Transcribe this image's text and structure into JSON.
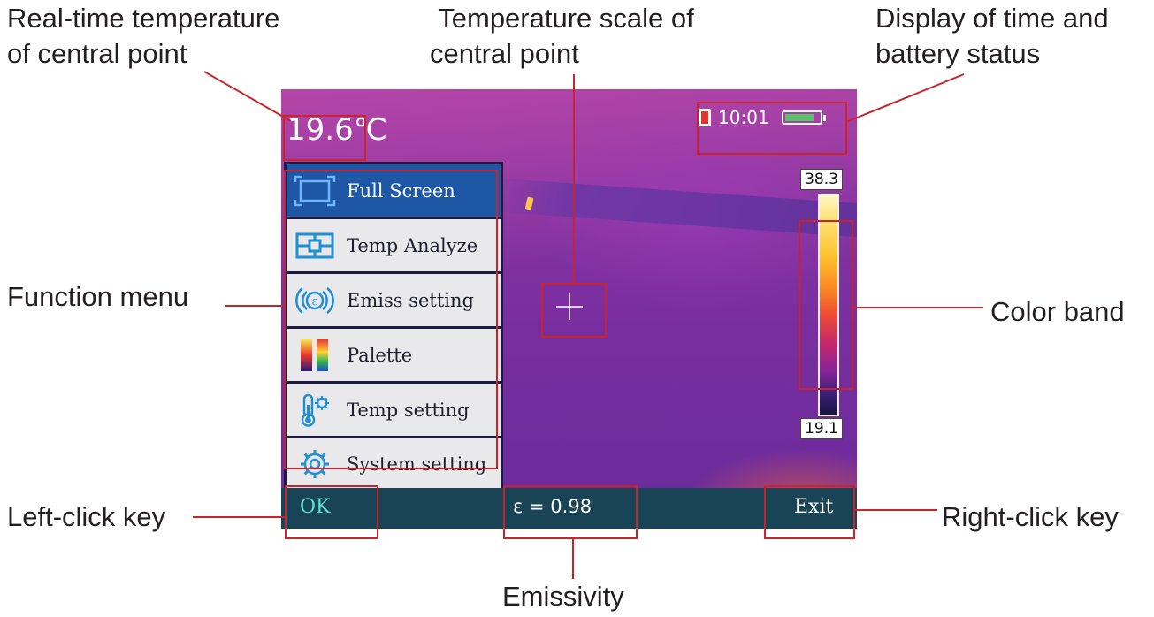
{
  "callouts": {
    "center_temp_line1": "Real-time temperature",
    "center_temp_line2": "of central point",
    "scale_line1": "Temperature scale of",
    "scale_line2": "central point",
    "time_battery_line1": "Display of time and",
    "time_battery_line2": "battery status",
    "function_menu": "Function menu",
    "color_band": "Color band",
    "left_click": "Left-click key",
    "right_click": "Right-click key",
    "emissivity": "Emissivity"
  },
  "screen": {
    "center_temperature": "19.6℃",
    "time": "10:01",
    "battery_level": 0.85,
    "scale_max": "38.3",
    "scale_min": "19.1",
    "menu": [
      {
        "label": "Full Screen",
        "icon": "full-screen-icon",
        "active": true
      },
      {
        "label": "Temp Analyze",
        "icon": "temp-analyze-icon",
        "active": false
      },
      {
        "label": "Emiss setting",
        "icon": "emissivity-icon",
        "active": false
      },
      {
        "label": "Palette",
        "icon": "palette-icon",
        "active": false
      },
      {
        "label": "Temp setting",
        "icon": "thermometer-gear-icon",
        "active": false
      },
      {
        "label": "System setting",
        "icon": "gear-icon",
        "active": false
      }
    ],
    "bottom_bar": {
      "left_key": "OK",
      "emissivity_value": "ε = 0.98",
      "right_key": "Exit"
    }
  },
  "colors": {
    "callout_line": "#c9242b",
    "menu_active": "#1d57a6",
    "bottom_bar": "#194456",
    "battery": "#5cc26b"
  }
}
